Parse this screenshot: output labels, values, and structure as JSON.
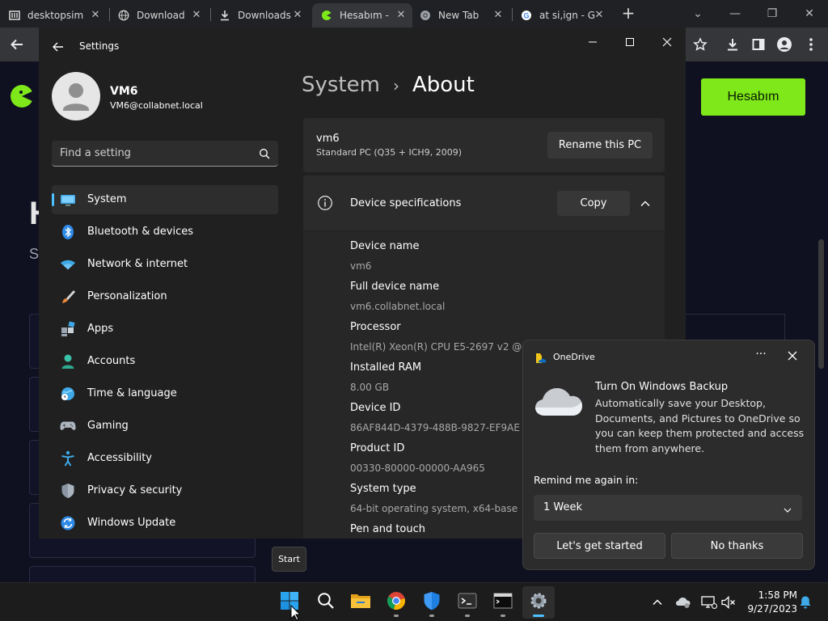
{
  "browser": {
    "tabs": [
      {
        "title": "desktopsim",
        "icon": "desktopsim-favicon-icon",
        "active": false
      },
      {
        "title": "Download",
        "icon": "globe-icon",
        "active": false
      },
      {
        "title": "Downloads",
        "icon": "download-icon",
        "active": false
      },
      {
        "title": "Hesabım - ",
        "icon": "gamer-site-favicon-icon",
        "active": true
      },
      {
        "title": "New Tab",
        "icon": "chrome-icon",
        "active": false
      },
      {
        "title": "at si,ign - G",
        "icon": "google-icon",
        "active": false
      }
    ],
    "new_tab_symbol": "+"
  },
  "webpage": {
    "account_button": "Hesabım",
    "big_letter": "H",
    "small_letter": "S"
  },
  "settings": {
    "window_title": "Settings",
    "user": {
      "name": "VM6",
      "email": "VM6@collabnet.local"
    },
    "search_placeholder": "Find a setting",
    "nav": [
      {
        "label": "System",
        "icon": "monitor-icon"
      },
      {
        "label": "Bluetooth & devices",
        "icon": "bluetooth-icon"
      },
      {
        "label": "Network & internet",
        "icon": "wifi-icon"
      },
      {
        "label": "Personalization",
        "icon": "paintbrush-icon"
      },
      {
        "label": "Apps",
        "icon": "apps-icon"
      },
      {
        "label": "Accounts",
        "icon": "person-icon"
      },
      {
        "label": "Time & language",
        "icon": "globe-clock-icon"
      },
      {
        "label": "Gaming",
        "icon": "gamepad-icon"
      },
      {
        "label": "Accessibility",
        "icon": "accessibility-icon"
      },
      {
        "label": "Privacy & security",
        "icon": "shield-icon"
      },
      {
        "label": "Windows Update",
        "icon": "update-icon"
      }
    ],
    "selected_nav": "System",
    "breadcrumb": {
      "parent": "System",
      "separator": "›",
      "current": "About"
    },
    "pc": {
      "name": "vm6",
      "model": "Standard PC (Q35 + ICH9, 2009)",
      "rename_label": "Rename this PC"
    },
    "spec": {
      "title": "Device specifications",
      "copy_label": "Copy",
      "items": [
        {
          "label": "Device name",
          "value": "vm6"
        },
        {
          "label": "Full device name",
          "value": "vm6.collabnet.local"
        },
        {
          "label": "Processor",
          "value": "Intel(R) Xeon(R) CPU E5-2697 v2 @"
        },
        {
          "label": "Installed RAM",
          "value": "8.00 GB"
        },
        {
          "label": "Device ID",
          "value": "86AF844D-4379-488B-9827-EF9AE"
        },
        {
          "label": "Product ID",
          "value": "00330-80000-00000-AA965"
        },
        {
          "label": "System type",
          "value": "64-bit operating system, x64-base"
        },
        {
          "label": "Pen and touch",
          "value": ""
        }
      ]
    }
  },
  "toast": {
    "app": "OneDrive",
    "more_symbol": "···",
    "heading": "Turn On Windows Backup",
    "body": "Automatically save your Desktop, Documents, and Pictures to OneDrive so you can keep them protected and access them from anywhere.",
    "remind_label": "Remind me again in:",
    "remind_value": "1 Week",
    "primary_button": "Let's get started",
    "secondary_button": "No thanks"
  },
  "tooltip": {
    "text": "Start"
  },
  "taskbar": {
    "apps": [
      {
        "name": "start-button",
        "icon": "windows-logo-icon",
        "active": false
      },
      {
        "name": "search-button",
        "icon": "search-icon",
        "active": false
      },
      {
        "name": "file-explorer-button",
        "icon": "folder-icon",
        "active": false
      },
      {
        "name": "chrome-button",
        "icon": "chrome-icon",
        "active": false
      },
      {
        "name": "defender-button",
        "icon": "shield-icon",
        "active": false
      },
      {
        "name": "terminal-button",
        "icon": "terminal-icon",
        "active": false
      },
      {
        "name": "cmd-button",
        "icon": "cmd-icon",
        "active": false
      },
      {
        "name": "settings-button",
        "icon": "gear-icon",
        "active": true
      }
    ],
    "clock": {
      "time": "1:58 PM",
      "date": "9/27/2023"
    }
  },
  "colors": {
    "accent": "#4cc2ff",
    "site_green": "#7ee81a",
    "window_bg": "#202020"
  }
}
